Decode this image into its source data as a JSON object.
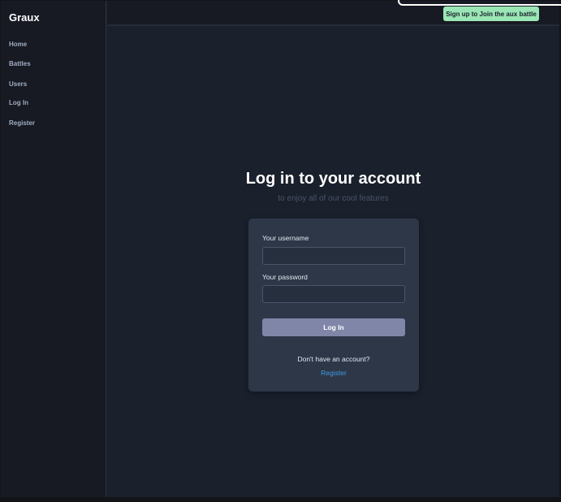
{
  "sidebar": {
    "brand": "Graux",
    "items": [
      {
        "label": "Home"
      },
      {
        "label": "Battles"
      },
      {
        "label": "Users"
      },
      {
        "label": "Log In"
      },
      {
        "label": "Register"
      }
    ]
  },
  "topbar": {
    "cta_label": "Sign up to Join the aux battle"
  },
  "login": {
    "title": "Log in to your account",
    "subtitle": "to enjoy all of our cool features",
    "username_label": "Your username",
    "username_value": "",
    "password_label": "Your password",
    "password_value": "",
    "submit_label": "Log In",
    "no_account_text": "Don't have an account?",
    "register_link": "Register"
  },
  "colors": {
    "background": "#1a202c",
    "sidebar": "#171923",
    "card": "#2d3748",
    "button": "#7f86a8",
    "cta": "#9ae6b4",
    "link": "#4299e1"
  }
}
